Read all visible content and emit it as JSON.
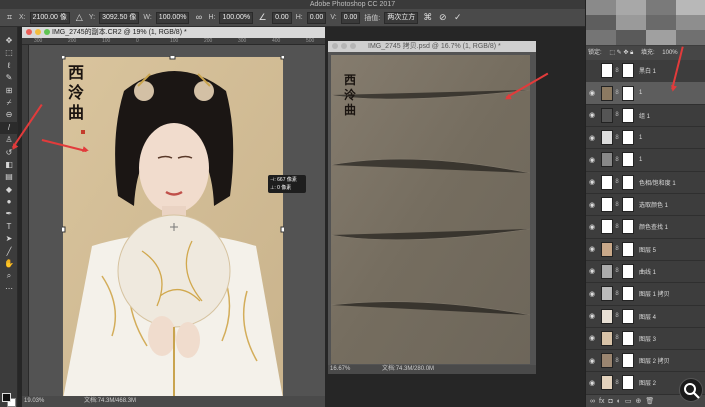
{
  "app": {
    "title": "Adobe Photoshop CC 2017"
  },
  "options_bar": {
    "x_label": "X:",
    "x_value": "2100.00 像",
    "y_label": "Y:",
    "y_value": "3092.50 像",
    "w_label": "W:",
    "w_value": "100.00%",
    "h_label": "H:",
    "h_value": "100.00%",
    "angle_value": "0.00",
    "hskew_label": "H:",
    "hskew_value": "0.00",
    "vskew_label": "V:",
    "vskew_value": "0.00",
    "interpolation": "两次立方",
    "cancel_icon": "cancel-icon",
    "commit_icon": "check-icon"
  },
  "doc1": {
    "title": "IMG_2745的副本.CR2 @ 19% (1, RGB/8) *",
    "ruler_marks": [
      "300",
      "200",
      "100",
      "0",
      "100",
      "200",
      "300",
      "400",
      "500"
    ],
    "calligraphy": [
      "西",
      "泠",
      "曲"
    ],
    "status_zoom": "19.03%",
    "status_doc": "文档:74.3M/468.3M",
    "tooltip_line1": "⊣: 667 像素",
    "tooltip_line2": "⊥:   0 像素"
  },
  "doc2": {
    "title": "IMG_2745 拷贝.psd @ 16.7% (1, RGB/8) *",
    "calligraphy": [
      "西",
      "泠",
      "曲"
    ],
    "status_zoom": "16.67%",
    "status_doc": "文档:74.3M/280.0M"
  },
  "layers_panel": {
    "head_labels": [
      "锁定:",
      "填充:",
      "100%"
    ],
    "layers": [
      {
        "name": "黑白 1",
        "visible": false
      },
      {
        "name": "1",
        "visible": true
      },
      {
        "name": "组 1",
        "visible": true
      },
      {
        "name": "1",
        "visible": true
      },
      {
        "name": "1",
        "visible": true
      },
      {
        "name": "色相/饱和度 1",
        "visible": true
      },
      {
        "name": "选取颜色 1",
        "visible": true
      },
      {
        "name": "颜色查找 1",
        "visible": true
      },
      {
        "name": "图层 5",
        "visible": true
      },
      {
        "name": "曲线 1",
        "visible": true
      },
      {
        "name": "图层 1 拷贝",
        "visible": true
      },
      {
        "name": "图层 4",
        "visible": true
      },
      {
        "name": "图层 3",
        "visible": true
      },
      {
        "name": "图层 2 拷贝",
        "visible": true
      },
      {
        "name": "图层 2",
        "visible": true
      }
    ],
    "footer_icons": [
      "link-icon",
      "fx-icon",
      "mask-icon",
      "adjustment-icon",
      "folder-icon",
      "new-layer-icon",
      "trash-icon"
    ]
  },
  "tools": [
    "move",
    "marquee",
    "lasso",
    "quick-select",
    "crop",
    "eyedropper",
    "healing",
    "brush",
    "stamp",
    "history-brush",
    "eraser",
    "gradient",
    "blur",
    "dodge",
    "pen",
    "type",
    "path-select",
    "shape",
    "hand",
    "zoom",
    "more"
  ],
  "colors": {
    "accent_red": "#e23b3b",
    "panel": "#3d3d3d",
    "canvas_bg": "#535353"
  }
}
